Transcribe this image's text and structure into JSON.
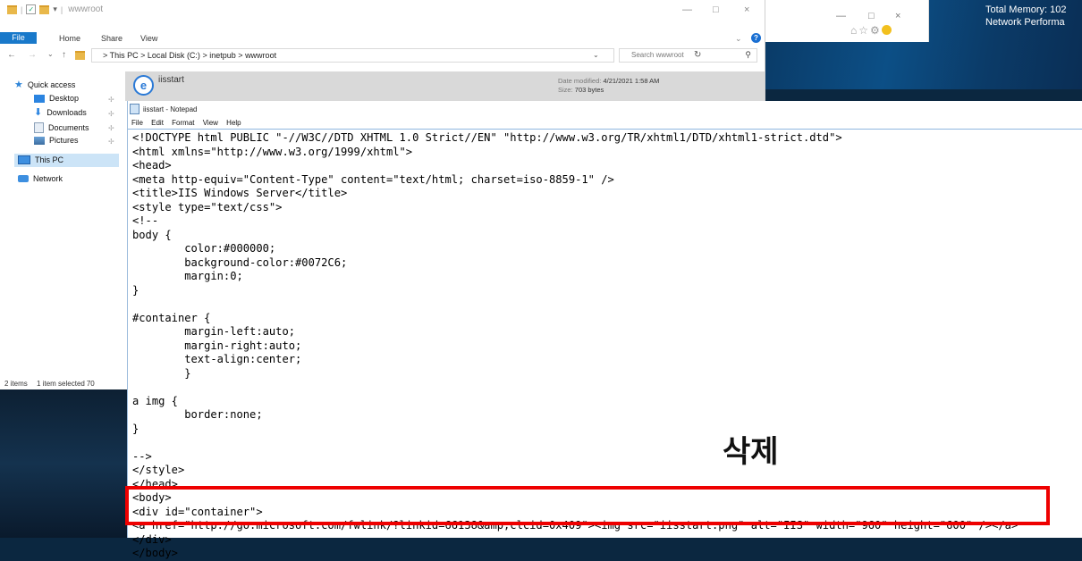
{
  "desktop": {
    "sysinfo": [
      "Total Memory: 102",
      "Network Performa"
    ]
  },
  "ie_window": {
    "controls": [
      "—",
      "□",
      "×"
    ],
    "icons": [
      "home-icon",
      "star-icon",
      "gear-icon",
      "smiley-icon"
    ]
  },
  "explorer": {
    "title": "wwwroot",
    "window_controls": [
      "—",
      "□",
      "×"
    ],
    "ribbon": {
      "file": "File",
      "tabs": [
        "Home",
        "Share",
        "View"
      ]
    },
    "nav": {
      "back": "←",
      "forward": "→",
      "recent": "⌄",
      "up": "↑"
    },
    "address": {
      "crumbs": [
        "This PC",
        "Local Disk (C:)",
        "inetpub",
        "wwwroot"
      ]
    },
    "search": {
      "placeholder": "Search wwwroot"
    },
    "sidebar": {
      "items": [
        {
          "label": "Quick access",
          "icon": "star-icon"
        },
        {
          "label": "Desktop",
          "icon": "desktop-icon"
        },
        {
          "label": "Downloads",
          "icon": "download-icon"
        },
        {
          "label": "Documents",
          "icon": "documents-icon"
        },
        {
          "label": "Pictures",
          "icon": "pictures-icon"
        },
        {
          "label": "This PC",
          "icon": "computer-icon"
        },
        {
          "label": "Network",
          "icon": "network-icon"
        }
      ]
    },
    "file": {
      "name": "iisstart",
      "date_label": "Date modified:",
      "date": "4/21/2021 1:58 AM",
      "size_label": "Size:",
      "size": "703 bytes"
    },
    "status": {
      "count": "2 items",
      "selected": "1 item selected",
      "extra": "70"
    }
  },
  "notepad": {
    "title": "iisstart - Notepad",
    "menu": [
      "File",
      "Edit",
      "Format",
      "View",
      "Help"
    ],
    "content": "<!DOCTYPE html PUBLIC \"-//W3C//DTD XHTML 1.0 Strict//EN\" \"http://www.w3.org/TR/xhtml1/DTD/xhtml1-strict.dtd\">\n<html xmlns=\"http://www.w3.org/1999/xhtml\">\n<head>\n<meta http-equiv=\"Content-Type\" content=\"text/html; charset=iso-8859-1\" />\n<title>IIS Windows Server</title>\n<style type=\"text/css\">\n<!--\nbody {\n        color:#000000;\n        background-color:#0072C6;\n        margin:0;\n}\n\n#container {\n        margin-left:auto;\n        margin-right:auto;\n        text-align:center;\n        }\n\na img {\n        border:none;\n}\n\n-->\n</style>\n</head>\n<body>\n<div id=\"container\">\n<a href=\"http://go.microsoft.com/fwlink/?linkid=66138&amp;clcid=0x409\"><img src=\"iisstart.png\" alt=\"IIS\" width=\"960\" height=\"600\" /></a>\n</div>\n</body>"
  },
  "annotation": {
    "label": "삭제",
    "color": "#ee0000"
  }
}
